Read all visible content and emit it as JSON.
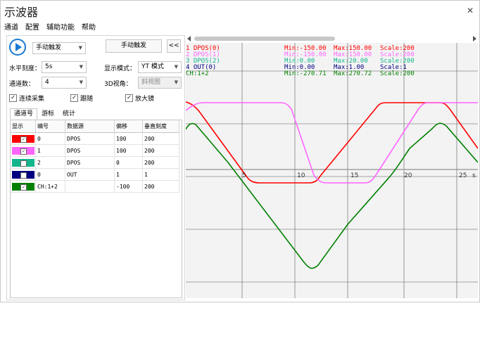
{
  "window": {
    "title": "示波器",
    "close_icon": "close-icon"
  },
  "menu": [
    "通道",
    "配置",
    "辅助功能",
    "帮助"
  ],
  "controls": {
    "trigger_mode": "手动触发",
    "trigger_button": "手动触发",
    "collapse_button": "<<",
    "horizontal_scale_label": "水平刻度：",
    "horizontal_scale_value": "5s",
    "display_mode_label": "显示模式：",
    "display_mode_value": "YT 模式",
    "channel_count_label": "通道数：",
    "channel_count_value": "4",
    "view3d_label": "3D视角：",
    "view3d_value": "斜视图",
    "continuous_label": "连续采集",
    "follow_label": "跟随",
    "magnifier_label": "放大镜"
  },
  "tabs": [
    "通道号",
    "游标",
    "统计"
  ],
  "table": {
    "headers": [
      "显示",
      "编号",
      "数据源",
      "偏移",
      "垂直刻度"
    ],
    "rows": [
      {
        "color": "#ff0000",
        "checked": true,
        "id": "0",
        "source": "DPOS",
        "offset": "100",
        "scale": "200"
      },
      {
        "color": "#ff66ff",
        "checked": true,
        "id": "1",
        "source": "DPOS",
        "offset": "100",
        "scale": "200"
      },
      {
        "color": "#13b58c",
        "checked": false,
        "id": "2",
        "source": "DPOS",
        "offset": "0",
        "scale": "200"
      },
      {
        "color": "#000080",
        "checked": false,
        "id": "0",
        "source": "OUT",
        "offset": "1",
        "scale": "1"
      },
      {
        "color": "#008000",
        "checked": true,
        "id": "CH:1+2",
        "source": "",
        "offset": "-100",
        "scale": "200"
      }
    ]
  },
  "legend": [
    {
      "label": "1 DPOS(0)",
      "min": "Min:-150.00",
      "max": "Max:150.00",
      "scale": "Scale:200",
      "color": "#ff0000"
    },
    {
      "label": "2 DPOS(1)",
      "min": "Min:-150.00",
      "max": "Max:150.00",
      "scale": "Scale:200",
      "color": "#ff66ff"
    },
    {
      "label": "3 DPOS(2)",
      "min": "Min:0.00",
      "max": "Max:20.00",
      "scale": "Scale:200",
      "color": "#13b58c"
    },
    {
      "label": "4 OUT(0)",
      "min": "Min:0.00",
      "max": "Max:1.00",
      "scale": "Scale:1",
      "color": "#000080"
    },
    {
      "label": "CH:1+2",
      "min": "Min:-270.71",
      "max": "Max:270.72",
      "scale": "Scale:200",
      "color": "#008000"
    }
  ],
  "axis_ticks": [
    "5",
    "10",
    "15",
    "20",
    "25",
    "s"
  ]
}
